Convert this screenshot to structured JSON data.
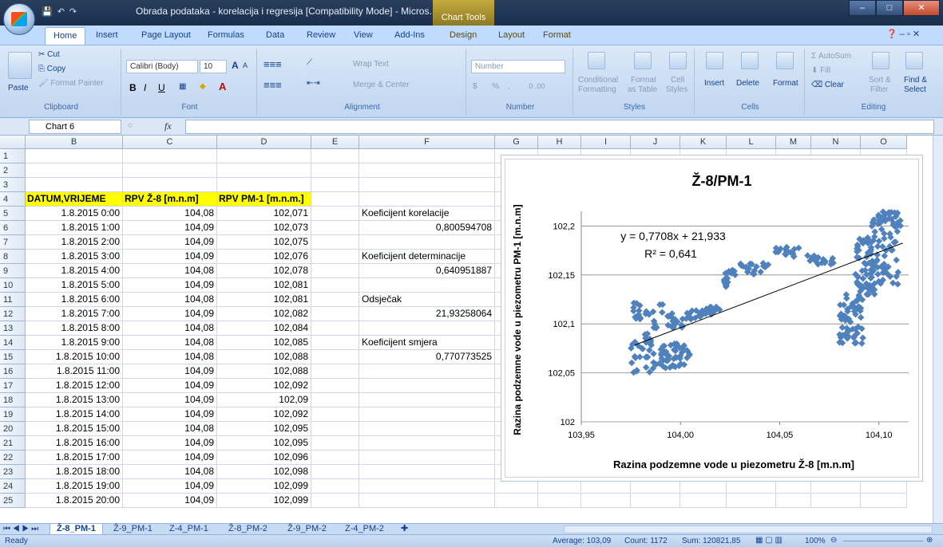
{
  "window": {
    "title": "Obrada podataka - korelacija i regresija  [Compatibility Mode] - Micros...",
    "context_tab": "Chart Tools"
  },
  "qat": {
    "save": "💾",
    "undo": "↶",
    "redo": "↷"
  },
  "tabs": [
    "Home",
    "Insert",
    "Page Layout",
    "Formulas",
    "Data",
    "Review",
    "View",
    "Add-Ins",
    "Design",
    "Layout",
    "Format"
  ],
  "ribbon": {
    "clipboard": {
      "paste": "Paste",
      "cut": "Cut",
      "copy": "Copy",
      "format_painter": "Format Painter",
      "label": "Clipboard"
    },
    "font": {
      "name": "Calibri (Body)",
      "size": "10",
      "bold": "B",
      "italic": "I",
      "underline": "U",
      "grow": "A",
      "shrink": "A",
      "label": "Font"
    },
    "alignment": {
      "wrap": "Wrap Text",
      "merge": "Merge & Center",
      "label": "Alignment"
    },
    "number": {
      "format": "Number",
      "percent": "%",
      "comma": ",",
      "inc": ".0 .00",
      "label": "Number"
    },
    "styles": {
      "cond": "Conditional",
      "cond2": "Formatting",
      "fat": "Format",
      "fat2": "as Table",
      "cell": "Cell",
      "cell2": "Styles",
      "label": "Styles"
    },
    "cells": {
      "insert": "Insert",
      "delete": "Delete",
      "format": "Format",
      "label": "Cells"
    },
    "editing": {
      "autosum": "AutoSum",
      "fill": "Fill",
      "clear": "Clear",
      "sort": "Sort &",
      "sort2": "Filter",
      "find": "Find &",
      "find2": "Select",
      "label": "Editing"
    }
  },
  "formula_bar": {
    "name_box": "Chart 6",
    "fx": "fx",
    "value": ""
  },
  "columns": [
    "B",
    "C",
    "D",
    "E",
    "F",
    "G",
    "H",
    "I",
    "J",
    "K",
    "L",
    "M",
    "N",
    "O"
  ],
  "rows": [
    "1",
    "2",
    "3",
    "4",
    "5",
    "6",
    "7",
    "8",
    "9",
    "10",
    "11",
    "12",
    "13",
    "14",
    "15",
    "16",
    "17",
    "18",
    "19",
    "20",
    "21",
    "22",
    "23",
    "24",
    "25"
  ],
  "table": {
    "headers": [
      "DATUM,VRIJEME",
      "RPV Ž-8 [m.n.m]",
      "RPV PM-1 [m.n.m.]"
    ],
    "rows": [
      [
        "1.8.2015 0:00",
        "104,08",
        "102,071"
      ],
      [
        "1.8.2015 1:00",
        "104,09",
        "102,073"
      ],
      [
        "1.8.2015 2:00",
        "104,09",
        "102,075"
      ],
      [
        "1.8.2015 3:00",
        "104,09",
        "102,076"
      ],
      [
        "1.8.2015 4:00",
        "104,08",
        "102,078"
      ],
      [
        "1.8.2015 5:00",
        "104,09",
        "102,081"
      ],
      [
        "1.8.2015 6:00",
        "104,08",
        "102,081"
      ],
      [
        "1.8.2015 7:00",
        "104,09",
        "102,082"
      ],
      [
        "1.8.2015 8:00",
        "104,08",
        "102,084"
      ],
      [
        "1.8.2015 9:00",
        "104,08",
        "102,085"
      ],
      [
        "1.8.2015 10:00",
        "104,08",
        "102,088"
      ],
      [
        "1.8.2015 11:00",
        "104,09",
        "102,088"
      ],
      [
        "1.8.2015 12:00",
        "104,09",
        "102,092"
      ],
      [
        "1.8.2015 13:00",
        "104,09",
        "102,09"
      ],
      [
        "1.8.2015 14:00",
        "104,09",
        "102,092"
      ],
      [
        "1.8.2015 15:00",
        "104,08",
        "102,095"
      ],
      [
        "1.8.2015 16:00",
        "104,09",
        "102,095"
      ],
      [
        "1.8.2015 17:00",
        "104,09",
        "102,096"
      ],
      [
        "1.8.2015 18:00",
        "104,08",
        "102,098"
      ],
      [
        "1.8.2015 19:00",
        "104,09",
        "102,099"
      ],
      [
        "1.8.2015 20:00",
        "104,09",
        "102,099"
      ]
    ]
  },
  "stats": {
    "korelacija_label": "Koeficijent korelacije",
    "korelacija_value": "0,800594708",
    "determinacija_label": "Koeficijent determinacije",
    "determinacija_value": "0,640951887",
    "odsjecak_label": "Odsječak",
    "odsjecak_value": "21,93258064",
    "smjer_label": "Koeficijent smjera",
    "smjer_value": "0,770773525"
  },
  "chart_data": {
    "type": "scatter",
    "title": "Ž-8/PM-1",
    "xlabel": "Razina podzemne vode u piezometru Ž-8 [m.n.m]",
    "ylabel": "Razina podzemne vode u piezometru PM-1 [m.n.m]",
    "xlim": [
      103.95,
      104.115
    ],
    "ylim": [
      102.0,
      102.215
    ],
    "xticks": [
      "103,95",
      "104,00",
      "104,05",
      "104,10"
    ],
    "yticks": [
      "102",
      "102,05",
      "102,1",
      "102,15",
      "102,2"
    ],
    "equation": "y = 0,7708x + 21,933",
    "r2": "R² = 0,641",
    "trendline": {
      "slope": 0.7708,
      "intercept": 21.933,
      "x": [
        103.977,
        104.112
      ]
    },
    "marker_color": "#4f81bd",
    "clusters": [
      {
        "x0": 103.975,
        "x1": 103.992,
        "y0": 102.049,
        "y1": 102.122
      },
      {
        "x0": 103.99,
        "x1": 104.005,
        "y0": 102.055,
        "y1": 102.08
      },
      {
        "x0": 103.993,
        "x1": 104.002,
        "y0": 102.096,
        "y1": 102.112
      },
      {
        "x0": 104.002,
        "x1": 104.012,
        "y0": 102.103,
        "y1": 102.114
      },
      {
        "x0": 104.012,
        "x1": 104.02,
        "y0": 102.109,
        "y1": 102.118
      },
      {
        "x0": 104.022,
        "x1": 104.024,
        "y0": 102.138,
        "y1": 102.152
      },
      {
        "x0": 104.024,
        "x1": 104.045,
        "y0": 102.15,
        "y1": 102.162
      },
      {
        "x0": 104.048,
        "x1": 104.06,
        "y0": 102.168,
        "y1": 102.18
      },
      {
        "x0": 104.064,
        "x1": 104.078,
        "y0": 102.16,
        "y1": 102.17
      },
      {
        "x0": 104.08,
        "x1": 104.092,
        "y0": 102.08,
        "y1": 102.13
      },
      {
        "x0": 104.088,
        "x1": 104.098,
        "y0": 102.13,
        "y1": 102.19
      },
      {
        "x0": 104.096,
        "x1": 104.11,
        "y0": 102.14,
        "y1": 102.212
      },
      {
        "x0": 104.1,
        "x1": 104.111,
        "y0": 102.2,
        "y1": 102.215
      }
    ]
  },
  "sheets": [
    "Ž-8_PM-1",
    "Ž-9_PM-1",
    "Z-4_PM-1",
    "Ž-8_PM-2",
    "Ž-9_PM-2",
    "Z-4_PM-2"
  ],
  "status": {
    "ready": "Ready",
    "average": "Average: 103,09",
    "count": "Count: 1172",
    "sum": "Sum: 120821,85",
    "zoom": "100%"
  }
}
